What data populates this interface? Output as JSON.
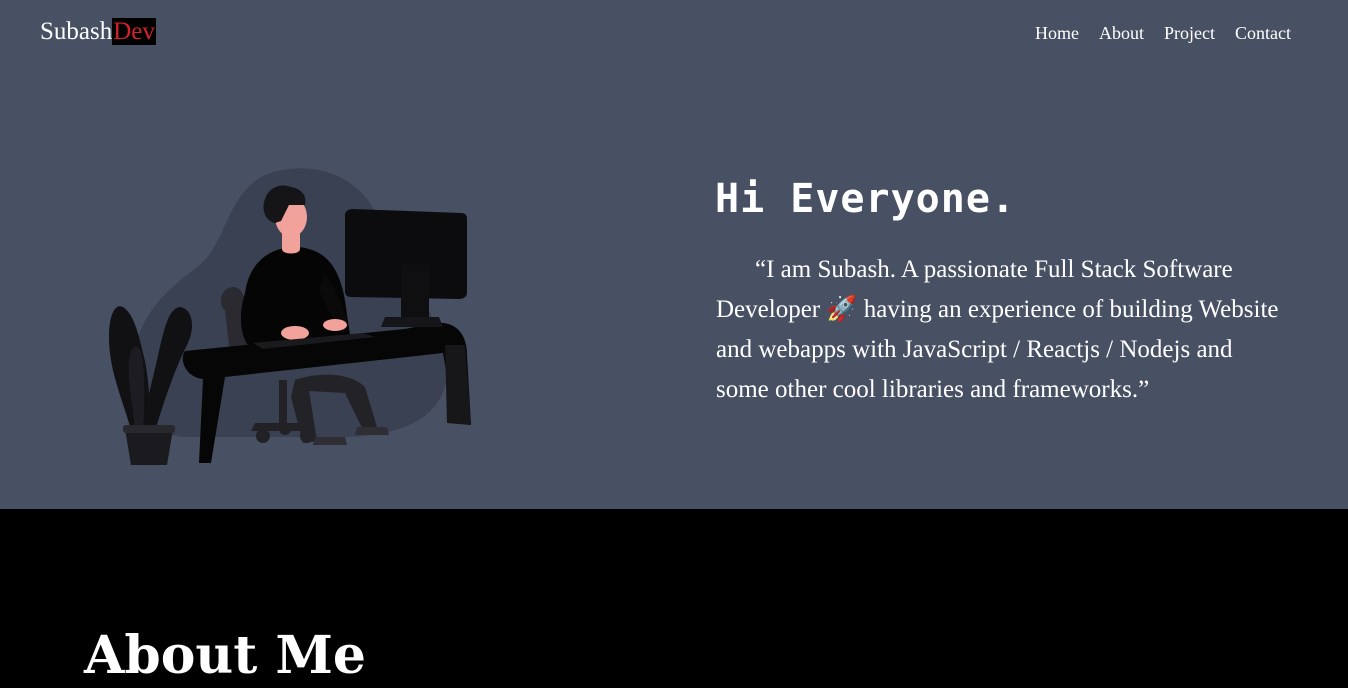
{
  "logo": {
    "main": "Subash",
    "accent": "Dev"
  },
  "nav": {
    "items": [
      "Home",
      "About",
      "Project",
      "Contact"
    ]
  },
  "hero": {
    "greeting": "Hi Everyone.",
    "intro": "“I am Subash. A passionate Full Stack Software Developer 🚀 having an experience of building Website and webapps with JavaScript / Reactjs / Nodejs and some other cool libraries and frameworks.”"
  },
  "about": {
    "heading": "About Me"
  },
  "colors": {
    "hero_bg": "#485063",
    "page_bg": "#000000",
    "accent": "#d2222b",
    "text": "#ffffff"
  },
  "icons": {
    "illustration": "developer-at-desk-illustration"
  }
}
